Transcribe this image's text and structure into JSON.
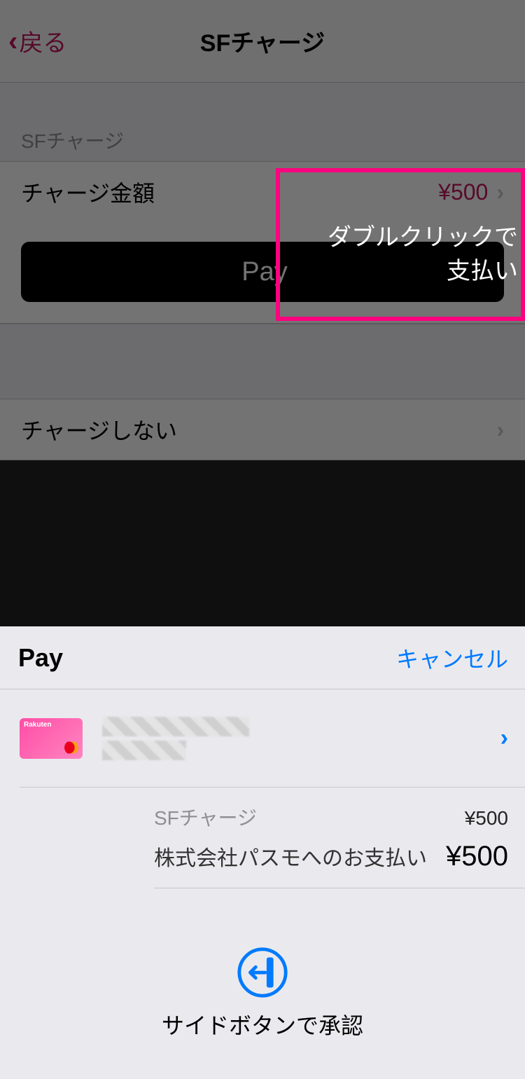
{
  "nav": {
    "back": "戻る",
    "title": "SFチャージ"
  },
  "section": {
    "header": "SFチャージ",
    "amount_label": "チャージ金額",
    "amount_value": "¥500"
  },
  "pay_button": {
    "label": "Pay"
  },
  "no_charge": {
    "label": "チャージしない"
  },
  "overlay_hint": {
    "line1": "ダブルクリックで",
    "line2": "支払い"
  },
  "sheet": {
    "logo_text": "Pay",
    "cancel": "キャンセル",
    "summary": {
      "item_label": "SFチャージ",
      "item_value": "¥500",
      "total_label": "株式会社パスモへのお支払い",
      "total_value": "¥500"
    },
    "confirm": "サイドボタンで承認"
  }
}
